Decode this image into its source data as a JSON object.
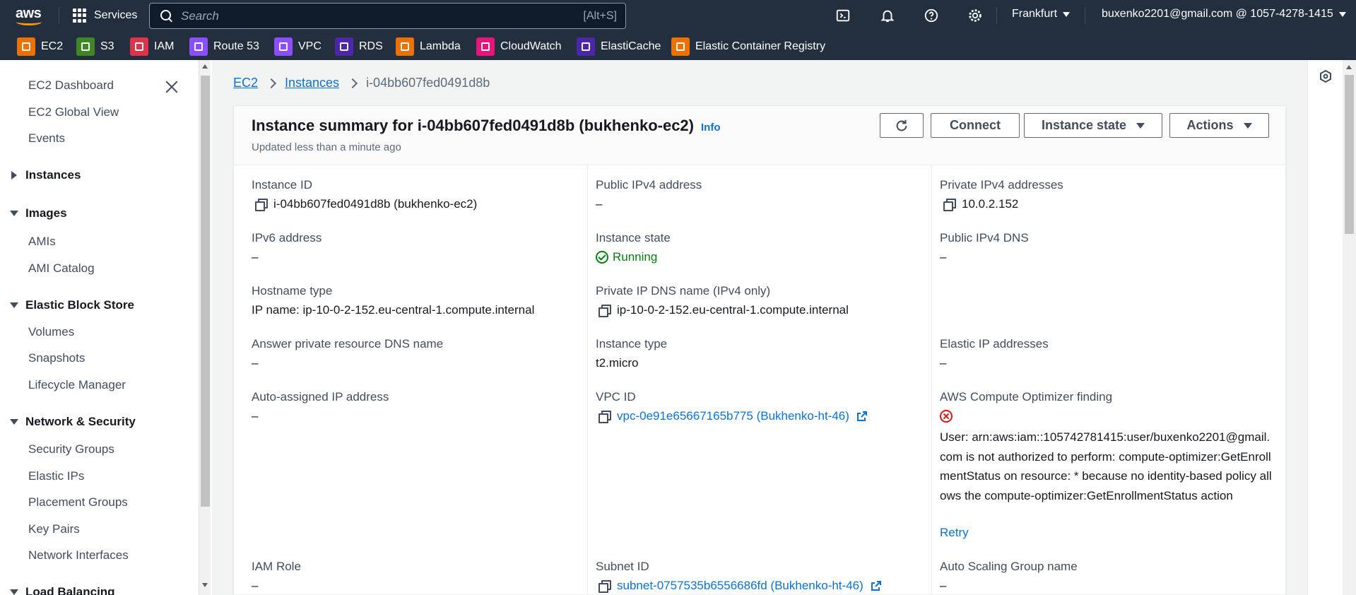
{
  "nav": {
    "logo": "aws",
    "services_label": "Services",
    "search_placeholder": "Search",
    "search_shortcut": "[Alt+S]",
    "region": "Frankfurt",
    "account": "buxenko2201@gmail.com @ 1057-4278-1415",
    "icons": [
      "cloudshell-icon",
      "notifications-icon",
      "help-icon",
      "settings-icon"
    ]
  },
  "favorites": [
    {
      "label": "EC2",
      "color": "#ed7100"
    },
    {
      "label": "S3",
      "color": "#3f8624"
    },
    {
      "label": "IAM",
      "color": "#dd344c"
    },
    {
      "label": "Route 53",
      "color": "#8c4fff"
    },
    {
      "label": "VPC",
      "color": "#8c4fff"
    },
    {
      "label": "RDS",
      "color": "#4d27aa"
    },
    {
      "label": "Lambda",
      "color": "#ed7100"
    },
    {
      "label": "CloudWatch",
      "color": "#e7157b"
    },
    {
      "label": "ElastiCache",
      "color": "#4d27aa"
    },
    {
      "label": "Elastic Container Registry",
      "color": "#ed7100"
    }
  ],
  "sidebar": {
    "items": [
      {
        "label": "EC2 Dashboard"
      },
      {
        "label": "EC2 Global View"
      },
      {
        "label": "Events"
      }
    ],
    "sections": [
      {
        "label": "Instances"
      },
      {
        "label": "Images"
      },
      {
        "label": "Elastic Block Store"
      },
      {
        "label": "Network & Security"
      },
      {
        "label": "Load Balancing"
      }
    ],
    "images_items": [
      "AMIs",
      "AMI Catalog"
    ],
    "ebs_items": [
      "Volumes",
      "Snapshots",
      "Lifecycle Manager"
    ],
    "netsec_items": [
      "Security Groups",
      "Elastic IPs",
      "Placement Groups",
      "Key Pairs",
      "Network Interfaces"
    ]
  },
  "breadcrumb": {
    "ec2": "EC2",
    "instances": "Instances",
    "current": "i-04bb607fed0491d8b"
  },
  "summary": {
    "title": "Instance summary for i-04bb607fed0491d8b (bukhenko-ec2)",
    "info": "Info",
    "updated": "Updated less than a minute ago",
    "btn_connect": "Connect",
    "btn_state": "Instance state",
    "btn_actions": "Actions"
  },
  "fields": {
    "instance_id_label": "Instance ID",
    "instance_id": "i-04bb607fed0491d8b (bukhenko-ec2)",
    "public_ipv4_label": "Public IPv4 address",
    "public_ipv4": "–",
    "private_ipv4_label": "Private IPv4 addresses",
    "private_ipv4": "10.0.2.152",
    "ipv6_label": "IPv6 address",
    "ipv6": "–",
    "state_label": "Instance state",
    "state": "Running",
    "public_dns_label": "Public IPv4 DNS",
    "public_dns": "–",
    "hostname_type_label": "Hostname type",
    "hostname_type": "IP name: ip-10-0-2-152.eu-central-1.compute.internal",
    "private_dns_label": "Private IP DNS name (IPv4 only)",
    "private_dns": "ip-10-0-2-152.eu-central-1.compute.internal",
    "answer_dns_label": "Answer private resource DNS name",
    "answer_dns": "–",
    "instance_type_label": "Instance type",
    "instance_type": "t2.micro",
    "elastic_ip_label": "Elastic IP addresses",
    "elastic_ip": "–",
    "auto_ip_label": "Auto-assigned IP address",
    "auto_ip": "–",
    "vpc_label": "VPC ID",
    "vpc": "vpc-0e91e65667165b775 (Bukhenko-ht-46)",
    "optimizer_label": "AWS Compute Optimizer finding",
    "optimizer_error": "User: arn:aws:iam::105742781415:user/buxenko2201@gmail.com is not authorized to perform: compute-optimizer:GetEnrollmentStatus on resource: * because no identity-based policy allows the compute-optimizer:GetEnrollmentStatus action",
    "retry": "Retry",
    "iam_label": "IAM Role",
    "iam": "–",
    "subnet_label": "Subnet ID",
    "subnet": "subnet-0757535b6556686fd (Bukhenko-ht-46)",
    "asg_label": "Auto Scaling Group name",
    "asg": "–"
  }
}
